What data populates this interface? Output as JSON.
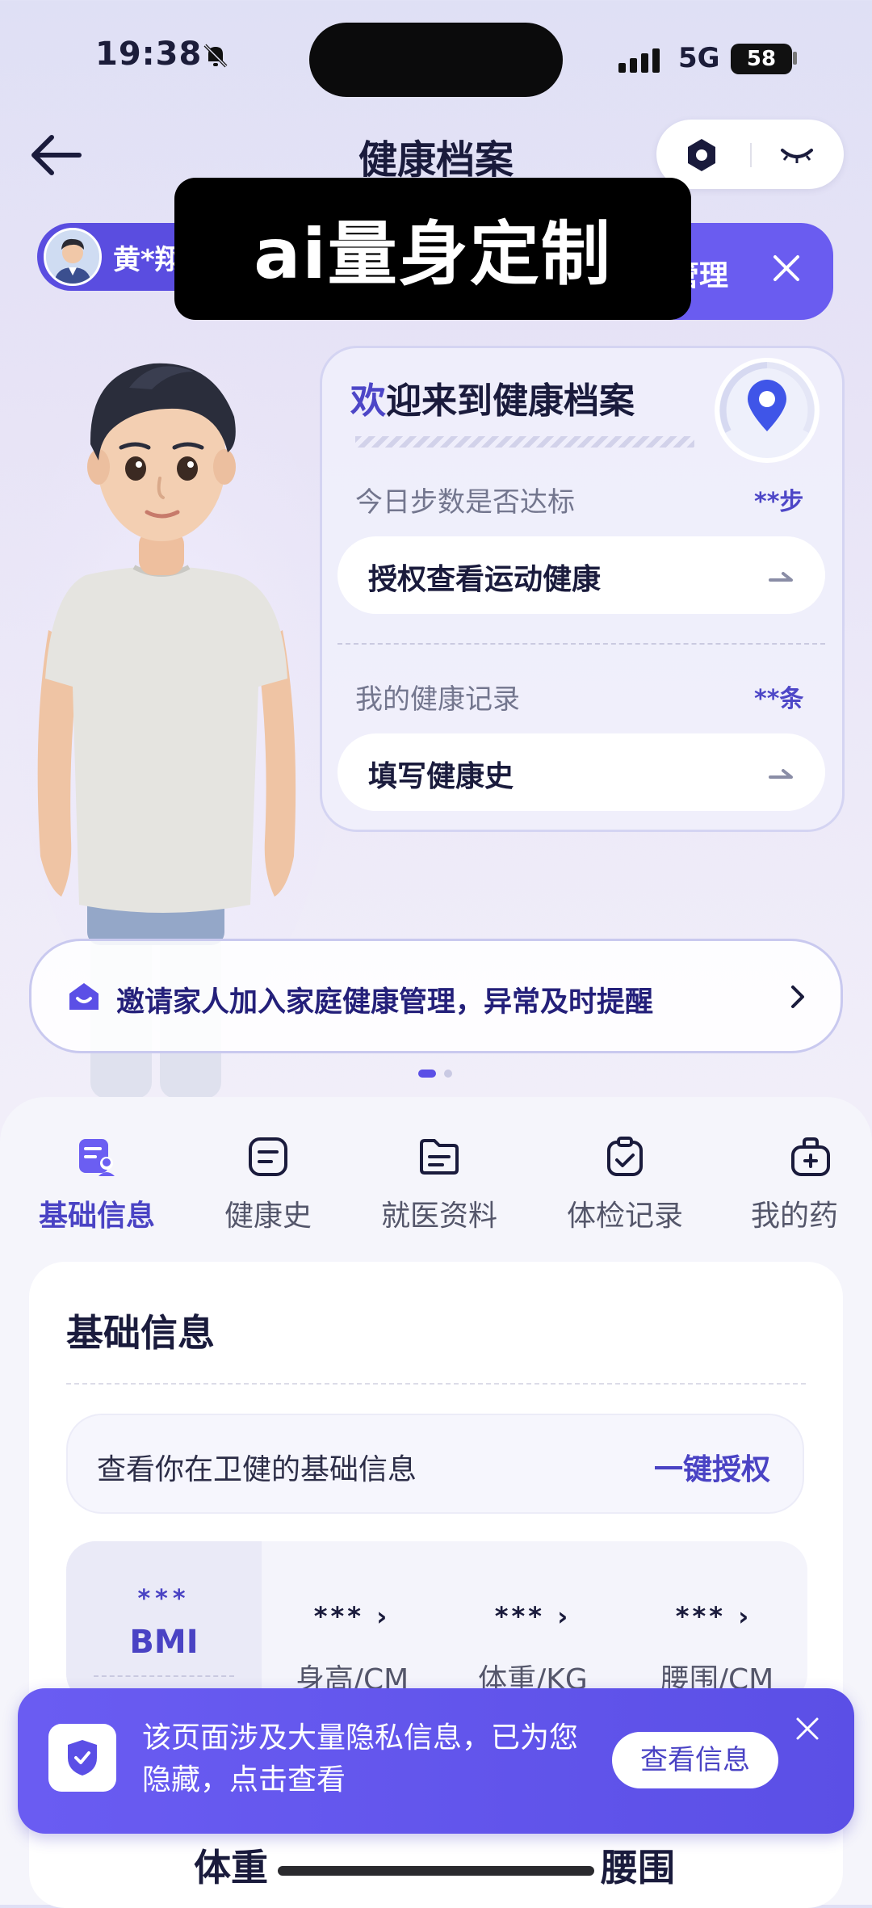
{
  "status_bar": {
    "time": "19:38",
    "network": "5G",
    "battery": "58"
  },
  "header": {
    "title": "健康档案"
  },
  "user": {
    "name": "黄*翔"
  },
  "manage": {
    "label": "管理"
  },
  "overlay": {
    "text": "ai量身定制"
  },
  "welcome": {
    "title_highlight": "欢",
    "title_rest": "迎来到健康档案",
    "steps_label": "今日步数是否达标",
    "steps_value": "**步",
    "steps_button": "授权查看运动健康",
    "records_label": "我的健康记录",
    "records_value": "**条",
    "records_button": "填写健康史"
  },
  "invite": {
    "text": "邀请家人加入家庭健康管理，异常及时提醒"
  },
  "tabs": [
    {
      "label": "基础信息",
      "icon": "profile-card-icon",
      "active": true
    },
    {
      "label": "健康史",
      "icon": "notes-icon"
    },
    {
      "label": "就医资料",
      "icon": "folder-icon"
    },
    {
      "label": "体检记录",
      "icon": "checklist-icon"
    },
    {
      "label": "我的药",
      "icon": "medicine-bag-icon"
    }
  ],
  "basic_info": {
    "title": "基础信息",
    "auth_text": "查看你在卫健的基础信息",
    "auth_link": "一键授权",
    "bmi_value": "***",
    "bmi_label": "BMI",
    "metrics": [
      {
        "value": "***",
        "label": "身高/CM"
      },
      {
        "value": "***",
        "label": "体重/KG"
      },
      {
        "value": "***",
        "label": "腰围/CM"
      }
    ],
    "section_left": "体重",
    "section_right": "腰围"
  },
  "privacy": {
    "text": "该页面涉及大量隐私信息，已为您隐藏，点击查看",
    "button": "查看信息"
  },
  "colors": {
    "accent": "#5b4fe6",
    "accent_dark": "#4a43c4"
  }
}
